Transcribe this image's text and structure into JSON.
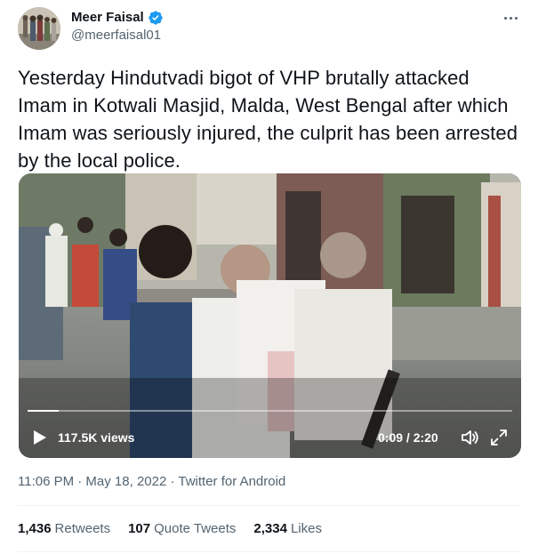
{
  "author": {
    "name": "Meer Faisal",
    "handle": "@meerfaisal01"
  },
  "tweet": {
    "text": "Yesterday Hindutvadi bigot of VHP brutally attacked Imam in Kotwali Masjid, Malda, West Bengal after which Imam was seriously injured, the culprit has been arrested by the local police."
  },
  "video": {
    "views": "117.5K views",
    "time": "0:09 / 2:20",
    "progress_fraction": 0.064
  },
  "meta": {
    "timestamp": "11:06 PM · May 18, 2022 · Twitter for Android"
  },
  "stats": {
    "retweets_count": "1,436",
    "retweets_label": "Retweets",
    "quotes_count": "107",
    "quotes_label": "Quote Tweets",
    "likes_count": "2,334",
    "likes_label": "Likes"
  },
  "colors": {
    "text_primary": "#0f1419",
    "text_secondary": "#536471",
    "verified": "#1d9bf0",
    "divider": "#eff3f4"
  },
  "icons": [
    "verified-badge-icon",
    "more-options-icon",
    "play-icon",
    "volume-icon",
    "fullscreen-icon"
  ]
}
